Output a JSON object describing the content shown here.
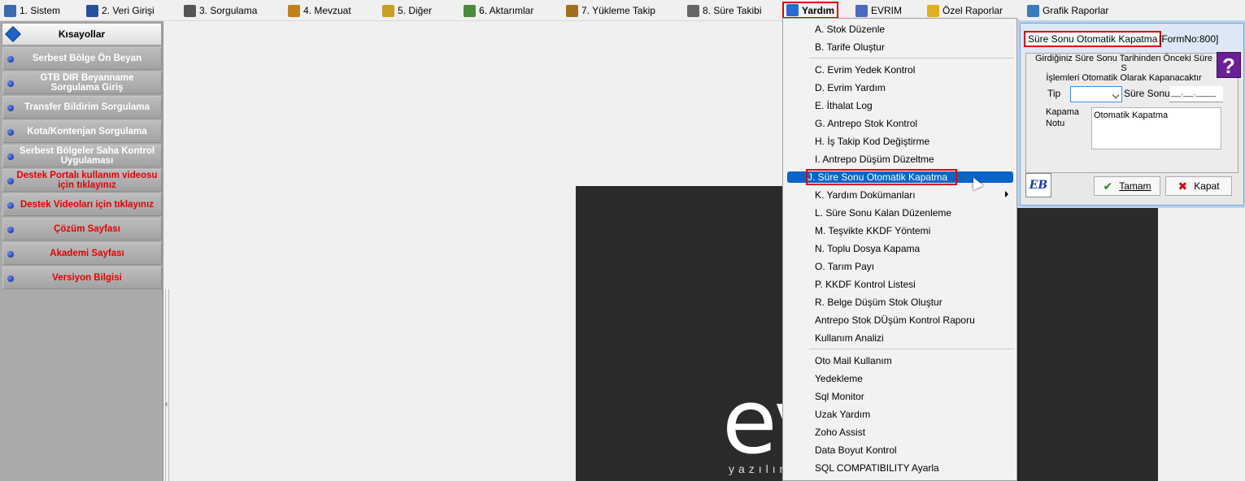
{
  "menubar": {
    "items": [
      {
        "label": "1.  Sistem",
        "icon": "pencil-icon",
        "color": "#3a6ab0"
      },
      {
        "label": "2.  Veri Girişi",
        "icon": "form-edit-icon",
        "color": "#2a4fa0"
      },
      {
        "label": "3.  Sorgulama",
        "icon": "query-icon",
        "color": "#555555"
      },
      {
        "label": "4.  Mevzuat",
        "icon": "books-icon",
        "color": "#c0801a"
      },
      {
        "label": "5.  Diğer",
        "icon": "people-icon",
        "color": "#c8a020"
      },
      {
        "label": "6.  Aktarımlar",
        "icon": "transfer-icon",
        "color": "#4a8a3a"
      },
      {
        "label": "7.  Yükleme Takip",
        "icon": "tracking-icon",
        "color": "#a07020"
      },
      {
        "label": "8. Süre Takibi",
        "icon": "calendar-icon",
        "color": "#666666"
      },
      {
        "label": "Yardım",
        "icon": "help-icon",
        "color": "#2a6ad0"
      },
      {
        "label": "EVRIM",
        "icon": "evrim-icon",
        "color": "#4a6ac0"
      },
      {
        "label": "Özel Raporlar",
        "icon": "star-icon",
        "color": "#e0b020"
      },
      {
        "label": "Grafik Raporlar",
        "icon": "chart-icon",
        "color": "#3a7ac0"
      }
    ],
    "active_label": "Yardım"
  },
  "sidebar": {
    "title": "Kısayollar",
    "items": [
      {
        "label": "Serbest Bölge Ön Beyan",
        "red": false
      },
      {
        "label": "GTB DIR Beyanname Sorgulama Giriş",
        "red": false
      },
      {
        "label": "Transfer Bildirim Sorgulama",
        "red": false
      },
      {
        "label": "Kota/Kontenjan Sorgulama",
        "red": false
      },
      {
        "label": "Serbest Bölgeler Saha Kontrol Uygulaması",
        "red": false
      },
      {
        "label": "Destek Portalı kullanım videosu için tıklayınız",
        "red": true
      },
      {
        "label": "Destek Videoları için tıklayınız",
        "red": true
      },
      {
        "label": "Çözüm Sayfası",
        "red": true
      },
      {
        "label": "Akademi Sayfası",
        "red": true
      },
      {
        "label": "Versiyon Bilgisi",
        "red": true
      }
    ]
  },
  "main": {
    "logo_text": "ev",
    "logo_sub": "yazılım"
  },
  "dropdown": {
    "groups": [
      [
        {
          "label": "A.   Stok Düzenle"
        },
        {
          "label": "B.   Tarife Oluştur"
        }
      ],
      [
        {
          "label": "C.   Evrim Yedek Kontrol"
        },
        {
          "label": "D.   Evrim Yardım"
        },
        {
          "label": "E.   İthalat Log"
        },
        {
          "label": "G.   Antrepo Stok Kontrol"
        },
        {
          "label": "H.   İş Takip Kod Değiştirme"
        },
        {
          "label": "I.    Antrepo Düşüm Düzeltme"
        },
        {
          "label": "J.   Süre Sonu Otomatik Kapatma",
          "highlight": true
        },
        {
          "label": "K.   Yardım Dokümanları",
          "submenu": true
        },
        {
          "label": "L. Süre Sonu Kalan Düzenleme"
        },
        {
          "label": "M. Teşvikte KKDF Yöntemi"
        },
        {
          "label": "N. Toplu Dosya Kapama"
        },
        {
          "label": "O. Tarım Payı"
        },
        {
          "label": "P. KKDF Kontrol Listesi"
        },
        {
          "label": "R. Belge Düşüm Stok Oluştur"
        },
        {
          "label": "Antrepo Stok DÜşüm Kontrol Raporu"
        },
        {
          "label": "Kullanım Analizi"
        }
      ],
      [
        {
          "label": "Oto Mail Kullanım"
        },
        {
          "label": "Yedekleme"
        },
        {
          "label": "Sql Monitor"
        },
        {
          "label": "Uzak Yardım"
        },
        {
          "label": "Zoho Assist"
        },
        {
          "label": "Data Boyut Kontrol"
        },
        {
          "label": "SQL COMPATIBILITY Ayarla"
        }
      ]
    ]
  },
  "dialog": {
    "title": "Süre Sonu Otomatik Kapatma",
    "form_no": "[FormNo:800]",
    "info_line1": "Girdiğiniz Süre Sonu Tarihinden Önceki Süre S",
    "info_line2": "İşlemleri Otomatik Olarak Kapanacaktır",
    "help_glyph": "?",
    "tip_label": "Tip",
    "tip_value": "",
    "sure_sonu_label": "Süre Sonu",
    "sure_sonu_value": "__.__.____",
    "kapama_notu_label1": "Kapama",
    "kapama_notu_label2": "Notu",
    "kapama_notu_value": "Otomatik Kapatma",
    "logo_text": "EB",
    "ok_label": "Tamam",
    "cancel_label": "Kapat"
  },
  "colors": {
    "highlight_bg": "#0a64c8",
    "annotation_red": "#e00000",
    "sidebar_red_text": "#e60000",
    "ok_icon": "#1a8a1a",
    "cancel_icon": "#d01010"
  }
}
